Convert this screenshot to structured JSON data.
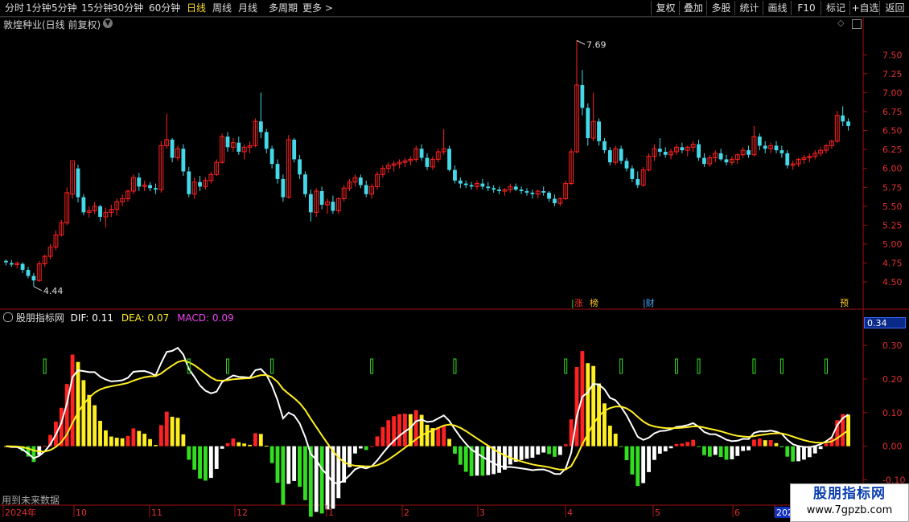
{
  "toolbar": {
    "periods": [
      "分时",
      "1分钟",
      "5分钟",
      "15分钟",
      "30分钟",
      "60分钟",
      "日线",
      "周线",
      "月线",
      "多周期",
      "更多 >"
    ],
    "active_period": "日线",
    "buttons": [
      "复权",
      "叠加",
      "多股",
      "统计",
      "画线",
      "F10",
      "标记",
      "+自选",
      "返回"
    ]
  },
  "stock": {
    "title": "敦煌种业(日线 前复权)"
  },
  "price_axis": {
    "ticks": [
      "7.50",
      "7.25",
      "7.00",
      "6.75",
      "6.50",
      "6.25",
      "6.00",
      "5.75",
      "5.50",
      "5.25",
      "5.00",
      "4.75",
      "4.50"
    ]
  },
  "annotations": {
    "high": "7.69",
    "low": "4.44"
  },
  "events": {
    "limit_up": "涨",
    "billboard": "榜",
    "finance": "财",
    "forecast": "预"
  },
  "indicator": {
    "name": "股朋指标网",
    "dif_label": "DIF: 0.11",
    "dea_label": "DEA: 0.07",
    "macd_label": "MACD: 0.09",
    "badge": "0.34",
    "axis_ticks": [
      "0.30",
      "0.20",
      "0.10",
      "0.00",
      "-0.10"
    ]
  },
  "date_axis": [
    "2024年",
    "10",
    "11",
    "12",
    "1",
    "2",
    "3",
    "4",
    "5",
    "6",
    "202"
  ],
  "footer_note": "用到未来数据",
  "watermark": {
    "title": "股朋指标网",
    "url": "www.7gpzb.com"
  },
  "colors": {
    "up": "#ff2222",
    "down": "#44d8e8",
    "dif": "#ffffff",
    "dea": "#ffee22",
    "hist_yellow": "#ffee22",
    "hist_green": "#33dd22",
    "grid_red": "#a01010"
  },
  "chart_data": {
    "type": "candlestick",
    "ylim": [
      4.3,
      7.8
    ],
    "series": [
      {
        "name": "candles",
        "values_ohlc": [
          [
            4.78,
            4.8,
            4.72,
            4.76
          ],
          [
            4.75,
            4.79,
            4.7,
            4.73
          ],
          [
            4.73,
            4.77,
            4.68,
            4.75
          ],
          [
            4.74,
            4.76,
            4.62,
            4.66
          ],
          [
            4.66,
            4.7,
            4.55,
            4.58
          ],
          [
            4.58,
            4.62,
            4.44,
            4.52
          ],
          [
            4.52,
            4.78,
            4.5,
            4.74
          ],
          [
            4.74,
            4.86,
            4.7,
            4.84
          ],
          [
            4.84,
            5.0,
            4.8,
            4.96
          ],
          [
            4.96,
            5.18,
            4.92,
            5.12
          ],
          [
            5.12,
            5.32,
            5.1,
            5.28
          ],
          [
            5.28,
            5.75,
            5.25,
            5.68
          ],
          [
            5.66,
            6.08,
            5.6,
            6.1
          ],
          [
            6.0,
            6.05,
            5.55,
            5.62
          ],
          [
            5.62,
            5.66,
            5.38,
            5.42
          ],
          [
            5.42,
            5.5,
            5.35,
            5.44
          ],
          [
            5.44,
            5.56,
            5.4,
            5.5
          ],
          [
            5.5,
            5.52,
            5.3,
            5.36
          ],
          [
            5.36,
            5.48,
            5.22,
            5.42
          ],
          [
            5.42,
            5.52,
            5.36,
            5.46
          ],
          [
            5.46,
            5.6,
            5.38,
            5.56
          ],
          [
            5.56,
            5.66,
            5.5,
            5.6
          ],
          [
            5.6,
            5.72,
            5.56,
            5.7
          ],
          [
            5.7,
            5.92,
            5.66,
            5.88
          ],
          [
            5.88,
            5.94,
            5.7,
            5.76
          ],
          [
            5.76,
            5.84,
            5.7,
            5.78
          ],
          [
            5.78,
            5.82,
            5.7,
            5.74
          ],
          [
            5.74,
            5.8,
            5.66,
            5.72
          ],
          [
            5.72,
            6.36,
            5.68,
            6.3
          ],
          [
            6.3,
            6.72,
            6.26,
            6.38
          ],
          [
            6.38,
            6.4,
            6.08,
            6.14
          ],
          [
            6.14,
            6.3,
            6.1,
            6.26
          ],
          [
            6.26,
            6.32,
            5.9,
            5.96
          ],
          [
            5.96,
            6.02,
            5.62,
            5.66
          ],
          [
            5.66,
            5.88,
            5.6,
            5.82
          ],
          [
            5.82,
            5.9,
            5.7,
            5.76
          ],
          [
            5.76,
            5.88,
            5.72,
            5.84
          ],
          [
            5.84,
            5.96,
            5.8,
            5.92
          ],
          [
            5.92,
            6.12,
            5.9,
            6.08
          ],
          [
            6.08,
            6.46,
            6.06,
            6.42
          ],
          [
            6.42,
            6.48,
            6.22,
            6.28
          ],
          [
            6.28,
            6.4,
            6.22,
            6.34
          ],
          [
            6.34,
            6.42,
            6.18,
            6.22
          ],
          [
            6.22,
            6.32,
            6.12,
            6.28
          ],
          [
            6.28,
            6.36,
            6.2,
            6.3
          ],
          [
            6.3,
            6.66,
            6.28,
            6.62
          ],
          [
            6.62,
            7.0,
            6.4,
            6.48
          ],
          [
            6.48,
            6.52,
            6.2,
            6.26
          ],
          [
            6.26,
            6.3,
            6.0,
            6.06
          ],
          [
            6.06,
            6.12,
            5.8,
            5.86
          ],
          [
            5.86,
            5.92,
            5.56,
            5.62
          ],
          [
            5.62,
            6.44,
            5.6,
            6.38
          ],
          [
            6.38,
            6.4,
            6.08,
            6.12
          ],
          [
            6.12,
            6.18,
            5.86,
            5.92
          ],
          [
            5.92,
            5.96,
            5.62,
            5.66
          ],
          [
            5.66,
            5.72,
            5.3,
            5.42
          ],
          [
            5.42,
            5.74,
            5.36,
            5.7
          ],
          [
            5.7,
            5.76,
            5.46,
            5.52
          ],
          [
            5.52,
            5.6,
            5.4,
            5.56
          ],
          [
            5.56,
            5.64,
            5.4,
            5.44
          ],
          [
            5.44,
            5.62,
            5.4,
            5.6
          ],
          [
            5.6,
            5.78,
            5.56,
            5.74
          ],
          [
            5.74,
            5.86,
            5.7,
            5.82
          ],
          [
            5.82,
            5.92,
            5.76,
            5.88
          ],
          [
            5.88,
            5.92,
            5.74,
            5.78
          ],
          [
            5.78,
            5.84,
            5.62,
            5.66
          ],
          [
            5.66,
            5.8,
            5.6,
            5.76
          ],
          [
            5.76,
            5.96,
            5.72,
            5.92
          ],
          [
            5.92,
            6.04,
            5.88,
            6.0
          ],
          [
            6.0,
            6.08,
            5.94,
            6.04
          ],
          [
            6.04,
            6.1,
            5.96,
            6.06
          ],
          [
            6.06,
            6.12,
            6.0,
            6.08
          ],
          [
            6.08,
            6.14,
            6.02,
            6.1
          ],
          [
            6.1,
            6.16,
            6.04,
            6.12
          ],
          [
            6.12,
            6.3,
            6.08,
            6.26
          ],
          [
            6.26,
            6.32,
            6.1,
            6.14
          ],
          [
            6.14,
            6.2,
            5.98,
            6.02
          ],
          [
            6.02,
            6.16,
            5.98,
            6.12
          ],
          [
            6.12,
            6.26,
            6.08,
            6.22
          ],
          [
            6.22,
            6.52,
            6.18,
            6.26
          ],
          [
            6.26,
            6.3,
            5.96,
            5.98
          ],
          [
            5.98,
            6.04,
            5.8,
            5.84
          ],
          [
            5.84,
            5.88,
            5.74,
            5.8
          ],
          [
            5.8,
            5.84,
            5.74,
            5.78
          ],
          [
            5.78,
            5.82,
            5.72,
            5.76
          ],
          [
            5.76,
            5.84,
            5.72,
            5.8
          ],
          [
            5.8,
            5.86,
            5.72,
            5.76
          ],
          [
            5.76,
            5.82,
            5.7,
            5.74
          ],
          [
            5.74,
            5.78,
            5.68,
            5.72
          ],
          [
            5.72,
            5.76,
            5.66,
            5.7
          ],
          [
            5.7,
            5.74,
            5.64,
            5.72
          ],
          [
            5.72,
            5.8,
            5.68,
            5.76
          ],
          [
            5.76,
            5.8,
            5.7,
            5.72
          ],
          [
            5.72,
            5.76,
            5.66,
            5.7
          ],
          [
            5.7,
            5.74,
            5.64,
            5.68
          ],
          [
            5.68,
            5.72,
            5.6,
            5.66
          ],
          [
            5.66,
            5.72,
            5.6,
            5.7
          ],
          [
            5.7,
            5.76,
            5.64,
            5.68
          ],
          [
            5.68,
            5.7,
            5.56,
            5.6
          ],
          [
            5.6,
            5.66,
            5.5,
            5.54
          ],
          [
            5.54,
            5.62,
            5.5,
            5.6
          ],
          [
            5.6,
            5.84,
            5.58,
            5.8
          ],
          [
            5.8,
            6.26,
            5.78,
            6.22
          ],
          [
            6.22,
            7.69,
            6.2,
            7.1
          ],
          [
            7.1,
            7.3,
            6.7,
            6.8
          ],
          [
            6.8,
            6.86,
            6.3,
            6.4
          ],
          [
            6.4,
            7.0,
            6.36,
            6.62
          ],
          [
            6.62,
            6.66,
            6.3,
            6.36
          ],
          [
            6.36,
            6.4,
            6.2,
            6.24
          ],
          [
            6.24,
            6.28,
            6.04,
            6.08
          ],
          [
            6.08,
            6.3,
            6.04,
            6.26
          ],
          [
            6.26,
            6.3,
            6.06,
            6.1
          ],
          [
            6.1,
            6.14,
            5.96,
            6.0
          ],
          [
            6.0,
            6.04,
            5.82,
            5.86
          ],
          [
            5.86,
            5.96,
            5.74,
            5.78
          ],
          [
            5.78,
            6.02,
            5.76,
            5.98
          ],
          [
            5.98,
            6.2,
            5.96,
            6.16
          ],
          [
            6.16,
            6.32,
            6.1,
            6.26
          ],
          [
            6.26,
            6.4,
            6.16,
            6.22
          ],
          [
            6.22,
            6.28,
            6.14,
            6.18
          ],
          [
            6.18,
            6.26,
            6.12,
            6.22
          ],
          [
            6.22,
            6.32,
            6.18,
            6.28
          ],
          [
            6.28,
            6.34,
            6.2,
            6.24
          ],
          [
            6.24,
            6.3,
            6.16,
            6.28
          ],
          [
            6.28,
            6.36,
            6.22,
            6.32
          ],
          [
            6.32,
            6.38,
            6.1,
            6.14
          ],
          [
            6.14,
            6.2,
            6.02,
            6.06
          ],
          [
            6.06,
            6.18,
            6.02,
            6.14
          ],
          [
            6.14,
            6.24,
            6.08,
            6.2
          ],
          [
            6.2,
            6.26,
            6.1,
            6.12
          ],
          [
            6.12,
            6.18,
            6.04,
            6.08
          ],
          [
            6.08,
            6.16,
            6.04,
            6.12
          ],
          [
            6.12,
            6.2,
            6.06,
            6.18
          ],
          [
            6.18,
            6.28,
            6.14,
            6.24
          ],
          [
            6.24,
            6.3,
            6.14,
            6.18
          ],
          [
            6.18,
            6.56,
            6.16,
            6.42
          ],
          [
            6.42,
            6.46,
            6.24,
            6.3
          ],
          [
            6.3,
            6.36,
            6.2,
            6.26
          ],
          [
            6.26,
            6.34,
            6.2,
            6.3
          ],
          [
            6.3,
            6.36,
            6.2,
            6.24
          ],
          [
            6.24,
            6.3,
            6.14,
            6.2
          ],
          [
            6.2,
            6.24,
            6.0,
            6.04
          ],
          [
            6.04,
            6.1,
            5.98,
            6.06
          ],
          [
            6.06,
            6.14,
            6.02,
            6.12
          ],
          [
            6.12,
            6.18,
            6.06,
            6.14
          ],
          [
            6.14,
            6.2,
            6.08,
            6.16
          ],
          [
            6.16,
            6.24,
            6.12,
            6.2
          ],
          [
            6.2,
            6.28,
            6.16,
            6.24
          ],
          [
            6.24,
            6.32,
            6.2,
            6.3
          ],
          [
            6.3,
            6.38,
            6.26,
            6.36
          ],
          [
            6.36,
            6.76,
            6.34,
            6.7
          ],
          [
            6.7,
            6.82,
            6.56,
            6.62
          ],
          [
            6.62,
            6.66,
            6.5,
            6.56
          ]
        ]
      }
    ]
  }
}
